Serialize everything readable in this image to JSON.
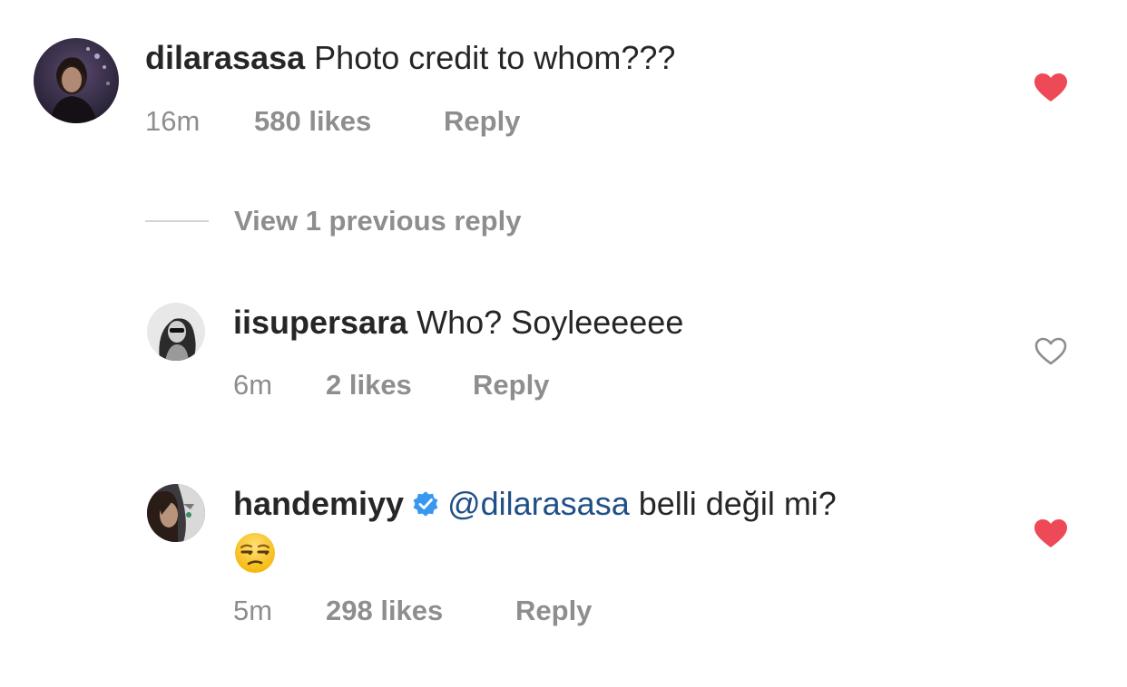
{
  "comments": [
    {
      "username": "dilarasasa",
      "text": "Photo credit to whom???",
      "time": "16m",
      "likes": "580 likes",
      "reply": "Reply",
      "liked": true,
      "avatar_icon": "profile-photo"
    },
    {
      "username": "iisupersara",
      "text": "Who? Soyleeeeee",
      "time": "6m",
      "likes": "2 likes",
      "reply": "Reply",
      "liked": false,
      "avatar_icon": "profile-photo"
    },
    {
      "username": "handemiyy",
      "verified": true,
      "mention": "@dilarasasa",
      "text": " belli değil mi?",
      "emoji_icon": "unamused-face-emoji",
      "time": "5m",
      "likes": "298 likes",
      "reply": "Reply",
      "liked": true,
      "avatar_icon": "profile-photo"
    }
  ],
  "view_replies": "View 1 previous reply",
  "colors": {
    "text": "#262626",
    "meta": "#8e8e8e",
    "heart_liked": "#ed4956",
    "heart_outline": "#8e8e8e",
    "mention": "#1f4f86",
    "verified": "#3897f0"
  }
}
